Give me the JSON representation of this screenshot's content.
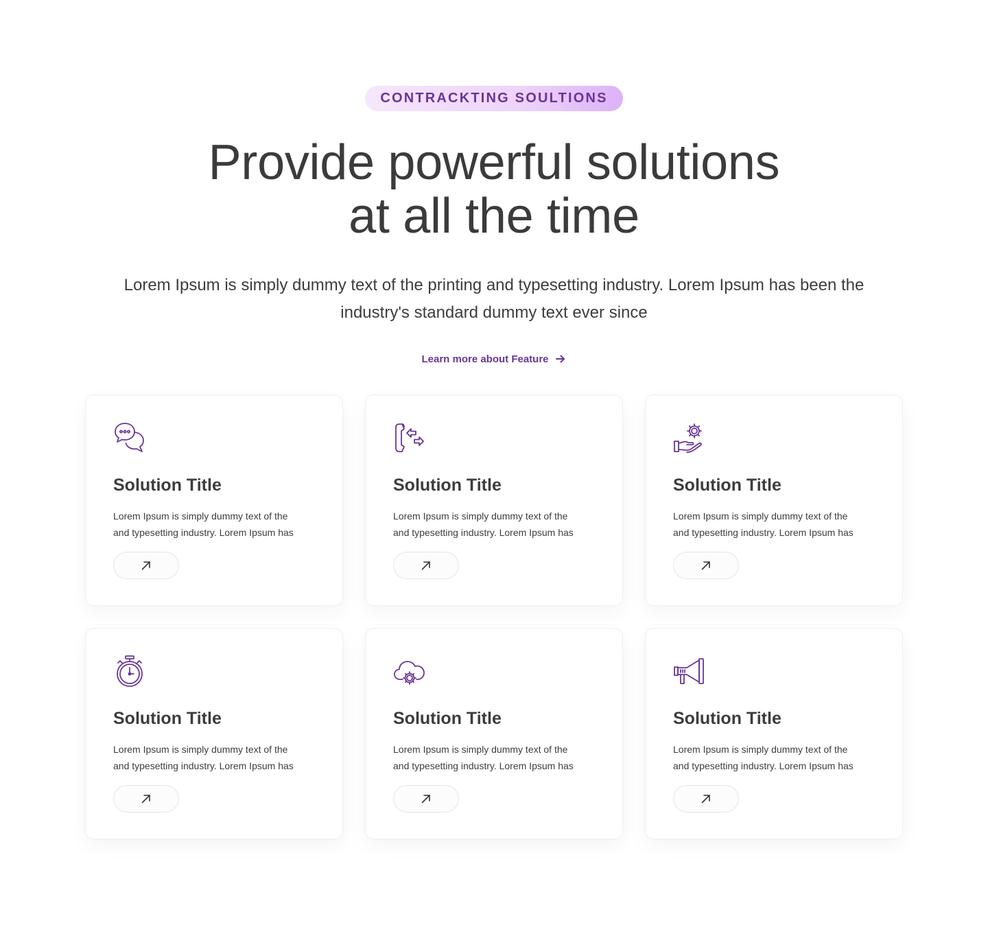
{
  "colors": {
    "accent": "#6a3597",
    "badge_bg_start": "#f6e7fd",
    "badge_bg_end": "#dcb2f8",
    "text": "#3d3d3d"
  },
  "hero": {
    "badge": "CONTRACKTING SOULTIONS",
    "title_line1": "Provide powerful solutions",
    "title_line2": "at all the time",
    "subtitle_line1": "Lorem Ipsum is simply dummy text of the printing and typesetting industry. Lorem Ipsum has been the",
    "subtitle_line2": "industry's standard dummy text ever since",
    "cta_label": "Learn more about Feature",
    "cta_icon": "arrow-right-icon"
  },
  "cards": [
    {
      "icon": "chat-bubbles-icon",
      "title": "Solution Title",
      "text_line1": "Lorem Ipsum is simply dummy text of the",
      "text_line2": "and typesetting industry. Lorem Ipsum has",
      "button_icon": "arrow-up-right-icon"
    },
    {
      "icon": "phone-transfer-icon",
      "title": "Solution Title",
      "text_line1": "Lorem Ipsum is simply dummy text of the",
      "text_line2": "and typesetting industry. Lorem Ipsum has",
      "button_icon": "arrow-up-right-icon"
    },
    {
      "icon": "hand-gear-icon",
      "title": "Solution Title",
      "text_line1": "Lorem Ipsum is simply dummy text of the",
      "text_line2": "and typesetting industry. Lorem Ipsum has",
      "button_icon": "arrow-up-right-icon"
    },
    {
      "icon": "stopwatch-icon",
      "title": "Solution Title",
      "text_line1": "Lorem Ipsum is simply dummy text of the",
      "text_line2": "and typesetting industry. Lorem Ipsum has",
      "button_icon": "arrow-up-right-icon"
    },
    {
      "icon": "cloud-gear-icon",
      "title": "Solution Title",
      "text_line1": "Lorem Ipsum is simply dummy text of the",
      "text_line2": "and typesetting industry. Lorem Ipsum has",
      "button_icon": "arrow-up-right-icon"
    },
    {
      "icon": "megaphone-icon",
      "title": "Solution Title",
      "text_line1": "Lorem Ipsum is simply dummy text of the",
      "text_line2": "and typesetting industry. Lorem Ipsum has",
      "button_icon": "arrow-up-right-icon"
    }
  ]
}
